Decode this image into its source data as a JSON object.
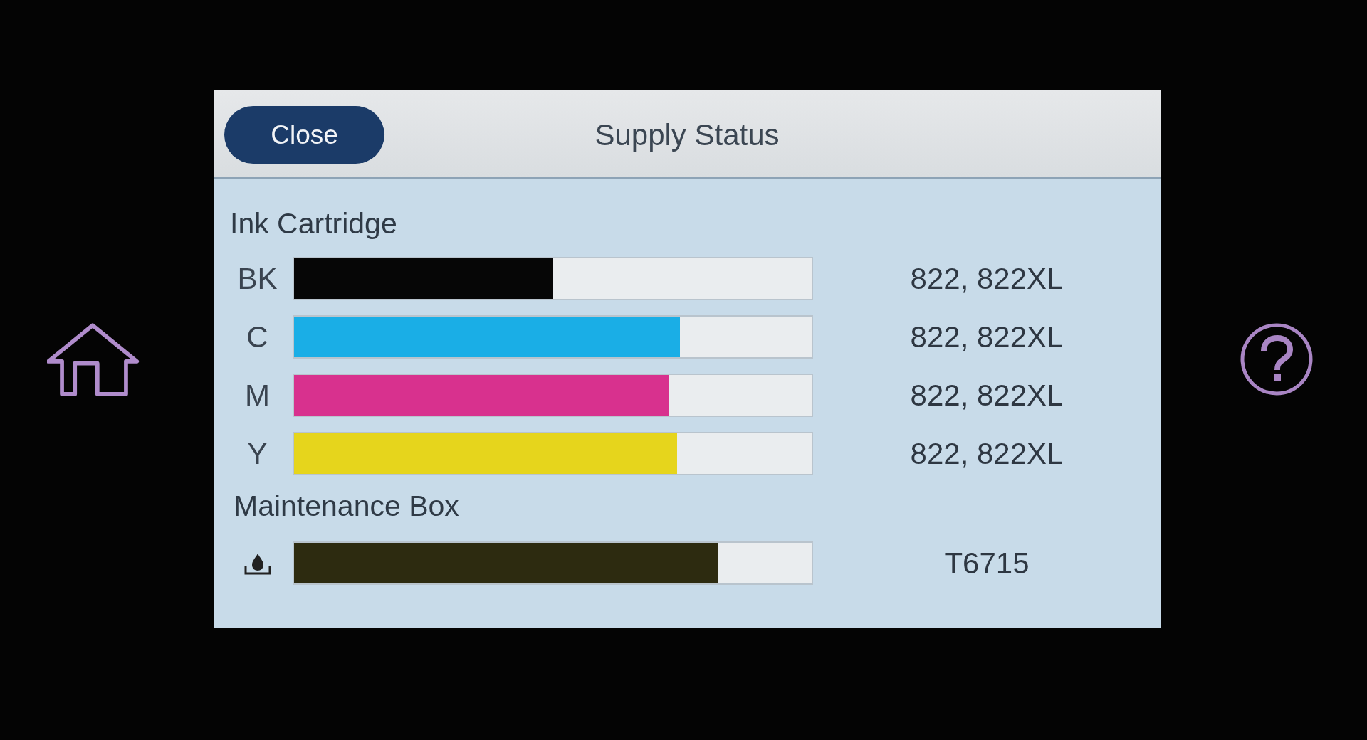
{
  "header": {
    "close_button": "Close",
    "title": "Supply Status"
  },
  "ink_cartridge": {
    "heading": "Ink Cartridge",
    "cartridges": [
      {
        "label": "BK",
        "color": "#060606",
        "level": 0.5,
        "model": "822, 822XL"
      },
      {
        "label": "C",
        "color": "#1aaee6",
        "level": 0.745,
        "model": "822, 822XL"
      },
      {
        "label": "M",
        "color": "#d8318e",
        "level": 0.725,
        "model": "822, 822XL"
      },
      {
        "label": "Y",
        "color": "#e6d51c",
        "level": 0.74,
        "model": "822, 822XL"
      }
    ]
  },
  "maintenance_box": {
    "heading": "Maintenance Box",
    "level": 0.82,
    "model": "T6715"
  }
}
